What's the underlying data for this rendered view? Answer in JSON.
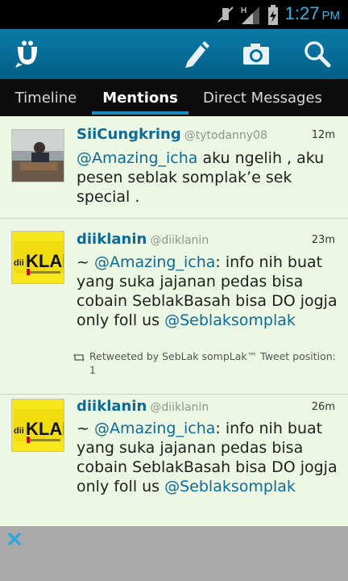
{
  "status_bar": {
    "time": "1:27",
    "ampm": "PM",
    "network": "H"
  },
  "tabs": [
    {
      "label": "Timeline"
    },
    {
      "label": "Mentions"
    },
    {
      "label": "Direct Messages"
    }
  ],
  "tweets": [
    {
      "name": "SiiCungkring",
      "handle": "@tytodanny08",
      "time": "12m",
      "mention": "@Amazing_icha",
      "text_after": " aku ngelih , aku pesen seblak somplak’e sek special ."
    },
    {
      "name": "diiklanin",
      "handle": "@diiklanin",
      "time": "23m",
      "prefix": "~ ",
      "mention": "@Amazing_icha",
      "text_after": ": info nih buat yang suka jajanan pedas bisa cobain SeblakBasah bisa DO jogja only foll us ",
      "mention2": "@Seblaksomplak",
      "retweet": "Retweeted by SebLak sompLak™ Tweet position: 1"
    },
    {
      "name": "diiklanin",
      "handle": "@diiklanin",
      "time": "26m",
      "prefix": "~ ",
      "mention": "@Amazing_icha",
      "text_after": ": info nih buat yang suka jajanan pedas bisa cobain SeblakBasah bisa DO jogja only foll us ",
      "mention2": "@Seblaksomplak"
    }
  ],
  "logo": {
    "brand_text": "KLAN",
    "brand_prefix": "dii"
  },
  "colors": {
    "action_bar": "#0a7aa8",
    "list_bg": "#ecf7e4",
    "name": "#0e6b97",
    "clock": "#33b5e5",
    "tab_indicator": "#1a8bc0",
    "bottom_bar": "#a9a9a9",
    "close_icon": "#2aa8e0"
  }
}
